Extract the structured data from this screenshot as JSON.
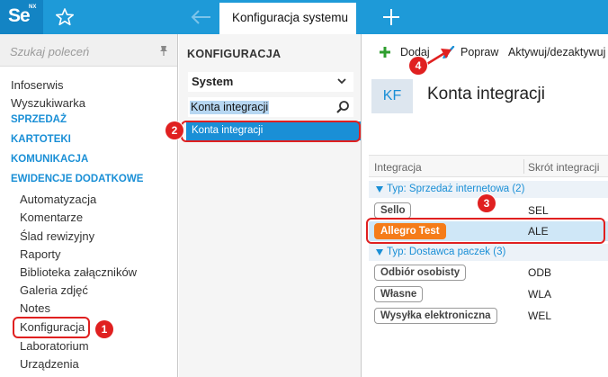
{
  "topbar": {
    "logo": "Se",
    "logo_suffix": "NX",
    "active_tab": "Konfiguracja systemu"
  },
  "sidebar": {
    "search_placeholder": "Szukaj poleceń",
    "items": [
      {
        "label": "Infoserwis",
        "kind": "item"
      },
      {
        "label": "Wyszukiwarka",
        "kind": "item"
      },
      {
        "label": "SPRZEDAŻ",
        "kind": "head"
      },
      {
        "label": "KARTOTEKI",
        "kind": "head"
      },
      {
        "label": "KOMUNIKACJA",
        "kind": "head"
      },
      {
        "label": "EWIDENCJE DODATKOWE",
        "kind": "head"
      },
      {
        "label": "Automatyzacja",
        "kind": "sub"
      },
      {
        "label": "Komentarze",
        "kind": "sub"
      },
      {
        "label": "Ślad rewizyjny",
        "kind": "sub"
      },
      {
        "label": "Raporty",
        "kind": "sub"
      },
      {
        "label": "Biblioteka załączników",
        "kind": "sub"
      },
      {
        "label": "Galeria zdjęć",
        "kind": "sub"
      },
      {
        "label": "Notes",
        "kind": "sub"
      },
      {
        "label": "Konfiguracja",
        "kind": "sub"
      },
      {
        "label": "Laboratorium",
        "kind": "sub"
      },
      {
        "label": "Urządzenia",
        "kind": "sub"
      }
    ]
  },
  "config_panel": {
    "title": "KONFIGURACJA",
    "select_value": "System",
    "search_value": "Konta integracji",
    "result": "Konta integracji"
  },
  "toolbar": {
    "add": "Dodaj",
    "edit": "Popraw",
    "toggle": "Aktywuj/dezaktywuj"
  },
  "page": {
    "badge": "KF",
    "title": "Konta integracji"
  },
  "grid": {
    "col_integration": "Integracja",
    "col_code": "Skrót integracji",
    "groups": [
      {
        "label": "Typ: Sprzedaż internetowa (2)",
        "rows": [
          {
            "name": "Sello",
            "code": "SEL"
          },
          {
            "name": "Allegro Test",
            "code": "ALE"
          }
        ]
      },
      {
        "label": "Typ: Dostawca paczek (3)",
        "rows": [
          {
            "name": "Odbiór osobisty",
            "code": "ODB"
          },
          {
            "name": "Własne",
            "code": "WLA"
          },
          {
            "name": "Wysyłka elektroniczna",
            "code": "WEL"
          }
        ]
      }
    ]
  },
  "callouts": [
    "1",
    "2",
    "3",
    "4"
  ],
  "colors": {
    "accent": "#1a8fd6",
    "topbar": "#1e9ad8",
    "selected_chip": "#f57c19",
    "annotation": "#e02020"
  }
}
